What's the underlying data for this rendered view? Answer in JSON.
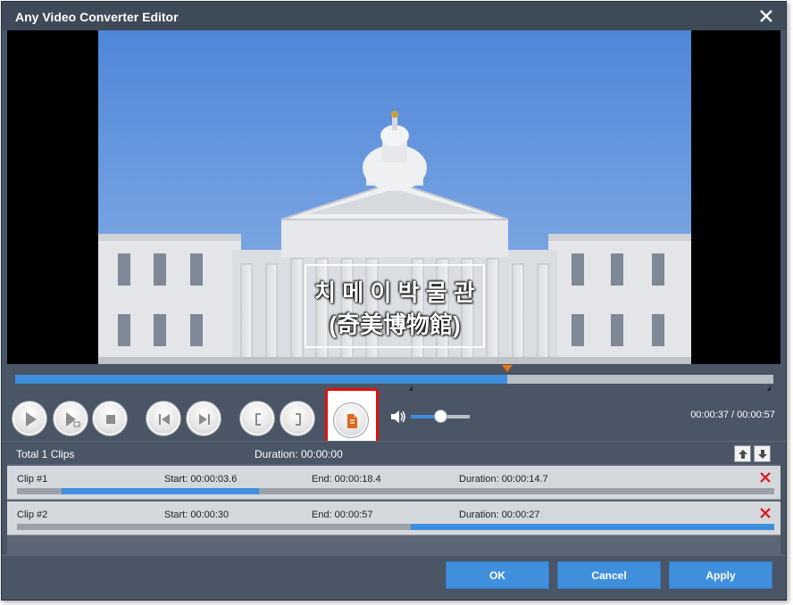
{
  "window": {
    "title": "Any Video Converter Editor",
    "close_icon": "close-icon"
  },
  "preview": {
    "subtitle_line1": "치 메 이 박 물 관",
    "subtitle_line2": "(奇美博物館)"
  },
  "timeline": {
    "progress_fraction": 0.649
  },
  "controls": {
    "play_icon": "play-icon",
    "play_clip_icon": "play-clip-icon",
    "stop_icon": "stop-icon",
    "prev_icon": "skip-back-icon",
    "next_icon": "skip-forward-icon",
    "mark_in_icon": "mark-in-icon",
    "mark_out_icon": "mark-out-icon",
    "cut_icon": "cut-clip-icon",
    "volume_icon": "volume-icon",
    "volume_fraction": 0.5,
    "time_readout": "00:00:37 / 00:00:57"
  },
  "clips": {
    "total_label": "Total 1 Clips",
    "duration_label": "Duration: 00:00:00",
    "move_up_icon": "arrow-up-icon",
    "move_down_icon": "arrow-down-icon",
    "rows": [
      {
        "name": "Clip #1",
        "start": "Start: 00:00:03.6",
        "end": "End: 00:00:18.4",
        "duration": "Duration: 00:00:14.7",
        "range_start": 0.059,
        "range_end": 0.32
      },
      {
        "name": "Clip #2",
        "start": "Start: 00:00:30",
        "end": "End: 00:00:57",
        "duration": "Duration: 00:00:27",
        "range_start": 0.52,
        "range_end": 1.0
      }
    ]
  },
  "footer": {
    "ok": "OK",
    "cancel": "Cancel",
    "apply": "Apply"
  },
  "colors": {
    "accent": "#3f8fdd",
    "window_bg": "#4a5565",
    "highlight_border": "#e01010",
    "delete_icon": "#d81818"
  }
}
